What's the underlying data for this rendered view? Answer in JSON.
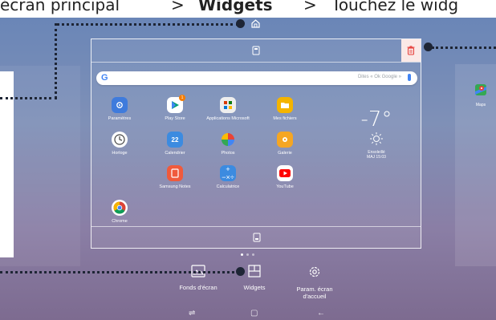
{
  "caption": {
    "part1": "écran principal",
    "sep1": ">",
    "bold": "Widgets",
    "sep2": ">",
    "part2": "Touchez le widg"
  },
  "search": {
    "logo": "G",
    "placeholder": "Dites « Ok Google »"
  },
  "apps": [
    {
      "label": "Paramètres",
      "color": "#3f7bdc"
    },
    {
      "label": "Play Store",
      "color": "#ffffff",
      "badge": "1"
    },
    {
      "label": "Applications Microsoft",
      "color": "#eeeeee"
    },
    {
      "label": "Mes fichiers",
      "color": "#f4b400"
    },
    {
      "label": "Horloge",
      "color": "#ffffff"
    },
    {
      "label": "Calendrier",
      "color": "#3c8be0",
      "text": "22"
    },
    {
      "label": "Photos",
      "color": "#ffffff"
    },
    {
      "label": "Galerie",
      "color": "#f5a623"
    },
    {
      "label": "Samsung Notes",
      "color": "#f05a3c"
    },
    {
      "label": "Calculatrice",
      "color": "#3c8be0"
    },
    {
      "label": "YouTube",
      "color": "#ffffff"
    },
    {
      "label": "Chrome",
      "color": "#ffffff"
    }
  ],
  "weather": {
    "temp": "-7°",
    "condition": "Ensoleillé",
    "updated": "MAJ 15:03"
  },
  "side_app": {
    "label": "Maps"
  },
  "bottom_buttons": [
    {
      "label": "Fonds d'écran"
    },
    {
      "label": "Widgets"
    },
    {
      "label": "Param. écran",
      "label2": "d'accueil"
    }
  ],
  "colors": {
    "callout": "#1e2535",
    "trash": "#e53935",
    "accent": "#4285f4"
  }
}
